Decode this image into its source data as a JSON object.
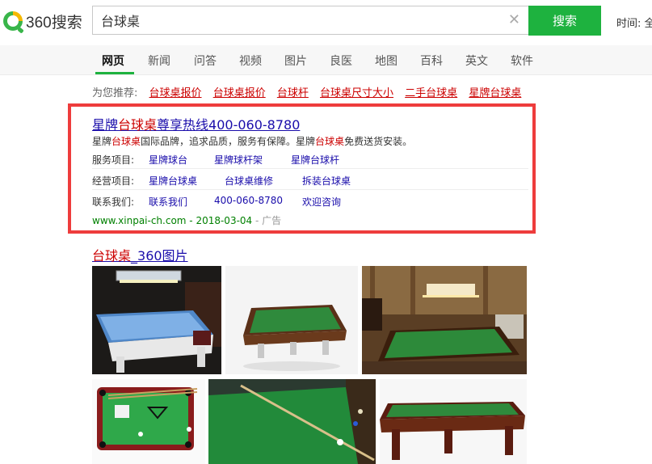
{
  "logo": {
    "text": "360搜索",
    "icon": "360-logo-icon"
  },
  "search": {
    "query": "台球桌",
    "button_label": "搜索",
    "clear_icon": "close-icon"
  },
  "time_filter": {
    "label": "时间: 全"
  },
  "nav": {
    "tabs": [
      {
        "label": "网页",
        "active": true
      },
      {
        "label": "新闻"
      },
      {
        "label": "问答"
      },
      {
        "label": "视频"
      },
      {
        "label": "图片"
      },
      {
        "label": "良医"
      },
      {
        "label": "地图"
      },
      {
        "label": "百科"
      },
      {
        "label": "英文"
      },
      {
        "label": "软件"
      }
    ]
  },
  "recommend": {
    "prefix": "为您推荐:",
    "items": [
      "台球桌报价",
      "台球桌报价",
      "台球杆",
      "台球桌尺寸大小",
      "二手台球桌",
      "星牌台球桌"
    ]
  },
  "ad": {
    "title_pre": "星牌",
    "title_hl": "台球桌",
    "title_post": "尊享热线400-060-8780",
    "desc": [
      "星牌",
      "台球桌",
      "国际品牌，追求品质，服务有保障。星牌",
      "台球桌",
      "免费送货安装。"
    ],
    "rows": [
      {
        "label": "服务项目:",
        "links": [
          "星牌球台",
          "星牌球杆架",
          "星牌台球杆"
        ]
      },
      {
        "label": "经营项目:",
        "links": [
          "星牌台球桌",
          "台球桌维修",
          "拆装台球桌"
        ]
      },
      {
        "label": "联系我们:",
        "links": [
          "联系我们",
          "400-060-8780",
          "欢迎咨询"
        ]
      }
    ],
    "url": "www.xinpai-ch.com - 2018-03-04",
    "ad_tag": " - 广告"
  },
  "images": {
    "title_hl": "台球桌",
    "title_post": "_360图片"
  },
  "colors": {
    "accent": "#1eb23f",
    "link": "#1a0dab",
    "highlight": "#c00000",
    "ad_border": "#ee3c3c",
    "url": "#008000"
  }
}
